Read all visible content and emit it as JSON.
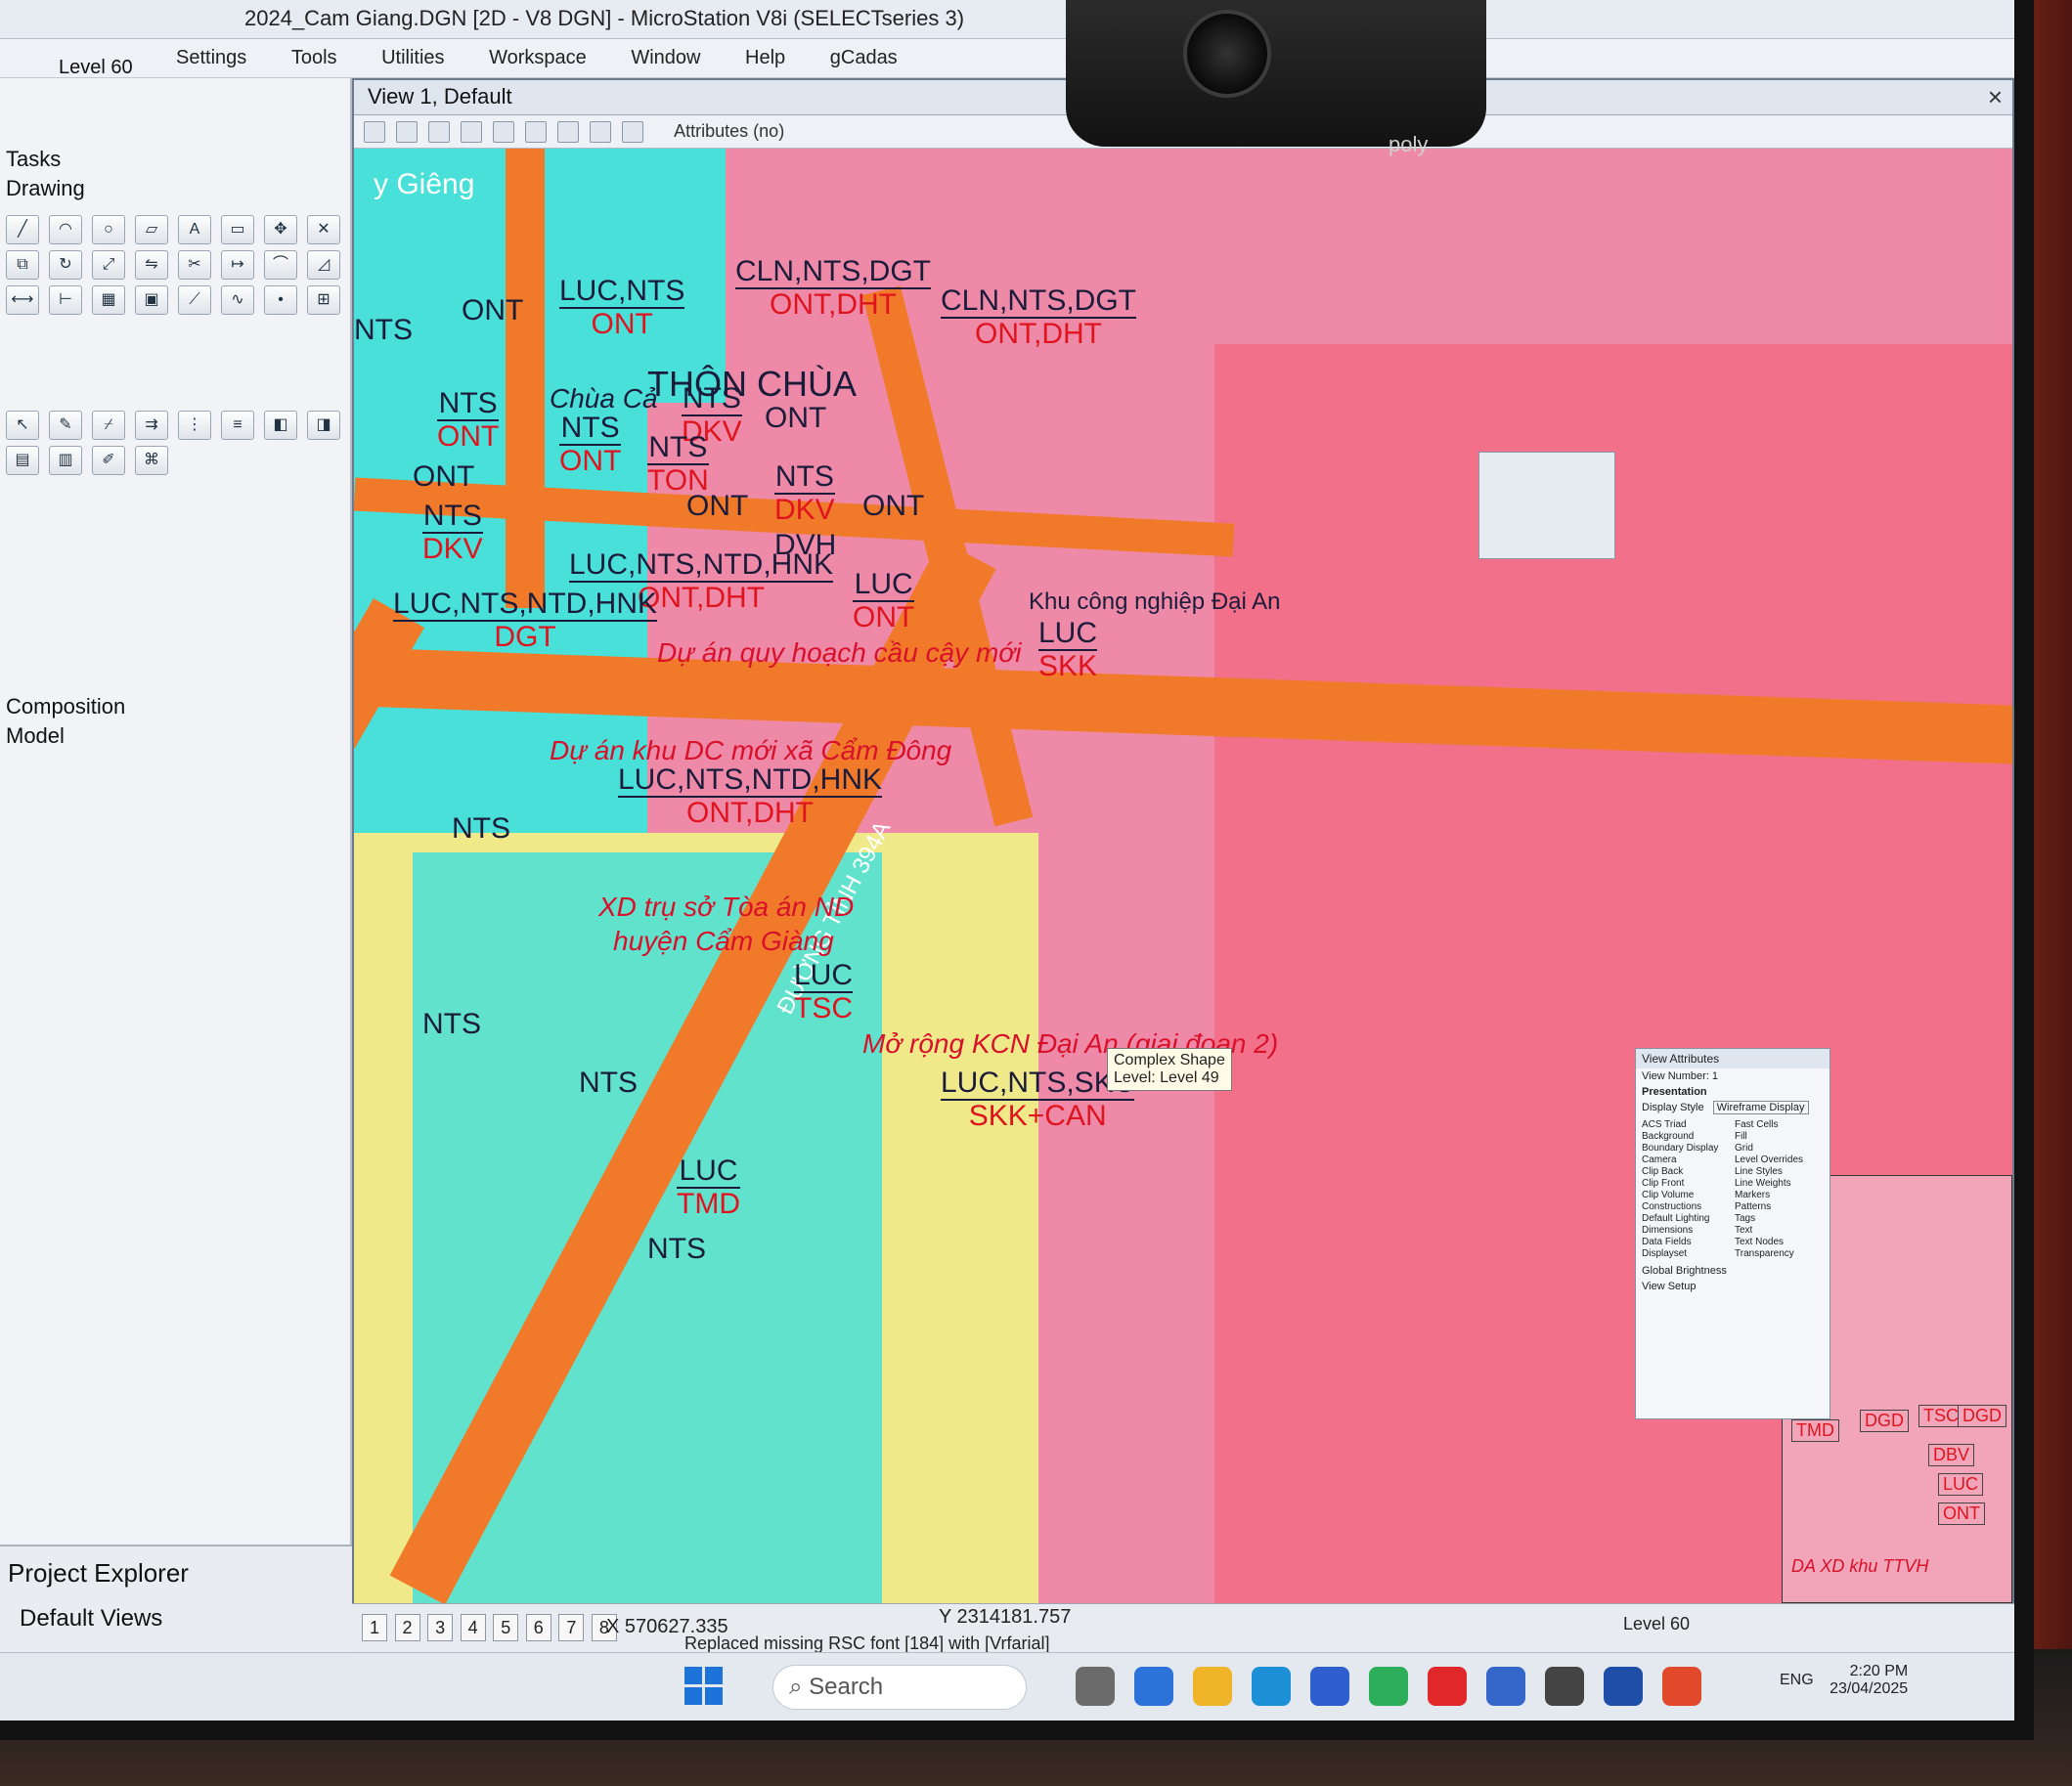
{
  "app": {
    "title": "2024_Cam Giang.DGN [2D - V8 DGN] - MicroStation V8i (SELECTseries 3)",
    "active_level": "Level 60",
    "menu": [
      "Settings",
      "Tools",
      "Utilities",
      "Workspace",
      "Window",
      "Help",
      "gCadas"
    ]
  },
  "tool_panel": {
    "tasks_heading": "Tasks",
    "drawing_heading": "Drawing",
    "composition_heading": "Composition",
    "model_heading": "Model",
    "project_explorer": "Project Explorer",
    "default_views": "Default Views"
  },
  "view": {
    "title": "View 1, Default",
    "close_label": "×",
    "toolbar_attr": "Attributes (no)"
  },
  "map": {
    "place_thon_chua": "THÔN CHÙA",
    "place_chua_ca": "Chùa Cả",
    "khu_cong_nghiep": "Khu công nghiệp Đại An",
    "road_label": "ĐƯỜNG TỈNH 394A",
    "labels": [
      {
        "top": "ONT",
        "bot": ""
      },
      {
        "top": "LUC,NTS",
        "bot": "ONT"
      },
      {
        "top": "CLN,NTS,DGT",
        "bot": "ONT,DHT"
      },
      {
        "top": "CLN,NTS,DGT",
        "bot": "ONT,DHT"
      },
      {
        "top": "NTS",
        "bot": ""
      },
      {
        "top": "NTS",
        "bot": "ONT"
      },
      {
        "top": "NTS",
        "bot": "ONT"
      },
      {
        "top": "NTS",
        "bot": "DKV"
      },
      {
        "top": "NTS",
        "bot": "TON"
      },
      {
        "top": "ONT",
        "bot": ""
      },
      {
        "top": "NTS",
        "bot": "DKV"
      },
      {
        "top": "ONT",
        "bot": ""
      },
      {
        "top": "NTS",
        "bot": "DKV"
      },
      {
        "top": "ONT",
        "bot": ""
      },
      {
        "top": "DVH",
        "bot": ""
      },
      {
        "top": "ONT",
        "bot": ""
      },
      {
        "top": "LUC,NTS,NTD,HNK",
        "bot": "ONT,DHT"
      },
      {
        "top": "LUC",
        "bot": "ONT"
      },
      {
        "top": "LUC",
        "bot": "SKK"
      },
      {
        "top": "LUC,NTS,NTD,HNK",
        "bot": "DGT"
      },
      {
        "top": "LUC,NTS,NTD,HNK",
        "bot": "ONT,DHT"
      },
      {
        "top": "NTS",
        "bot": ""
      },
      {
        "top": "LUC",
        "bot": "TSC"
      },
      {
        "top": "NTS",
        "bot": ""
      },
      {
        "top": "NTS",
        "bot": ""
      },
      {
        "top": "LUC,NTS,SKC",
        "bot": "SKK+CAN"
      },
      {
        "top": "LUC",
        "bot": "TMD"
      },
      {
        "top": "NTS",
        "bot": ""
      }
    ],
    "notes": {
      "quy_hoach": "Dự án quy hoạch cầu cậy mới",
      "khu_dc": "Dự án khu DC mới xã Cẩm Đông",
      "toa_an_1": "XD trụ sở Tòa án ND",
      "toa_an_2": "huyện Cẩm Giàng",
      "mo_rong": "Mở rộng KCN Đại An (giai đoạn 2)",
      "da_xd": "DA XD khu TTVH"
    },
    "right_tags": [
      "TMD",
      "DGD",
      "TSC",
      "DGD",
      "DBV",
      "LUC",
      "ONT"
    ],
    "giang_label": "y Giêng"
  },
  "tooltip": {
    "line1": "Complex Shape",
    "line2": "Level: Level 49"
  },
  "view_attributes": {
    "title": "View Attributes",
    "view_number": "View Number: 1",
    "presentation": "Presentation",
    "display_style": "Display Style",
    "display_value": "Wireframe Display",
    "options_left": [
      "ACS Triad",
      "Background",
      "Boundary Display",
      "Camera",
      "Clip Back",
      "Clip Front",
      "Clip Volume",
      "Constructions",
      "Default Lighting",
      "Dimensions",
      "Data Fields",
      "Displayset"
    ],
    "options_right": [
      "Fast Cells",
      "Fill",
      "Grid",
      "Level Overrides",
      "Line Styles",
      "Line Weights",
      "Markers",
      "Patterns",
      "Tags",
      "Text",
      "Text Nodes",
      "Transparency"
    ],
    "global_brightness": "Global Brightness",
    "view_setup": "View Setup"
  },
  "status": {
    "pages": [
      "1",
      "2",
      "3",
      "4",
      "5",
      "6",
      "7",
      "8"
    ],
    "x_label": "X",
    "x_value": "570627.335",
    "y_label": "Y",
    "y_value": "2314181.757",
    "message": "Replaced missing RSC font [184] with [Vrfarial]",
    "level": "Level 60"
  },
  "taskbar": {
    "search": "Search",
    "lang": "ENG",
    "time": "2:20 PM",
    "date": "23/04/2025"
  },
  "camera_brand": "poly",
  "colors": {
    "pink": "#ee8aa8",
    "salmon": "#f27089",
    "road": "#f07a2a",
    "cyan": "#48e0d8",
    "yellow": "#efe98a",
    "label_red": "#e0141e",
    "label_dark": "#1b1b3a"
  }
}
